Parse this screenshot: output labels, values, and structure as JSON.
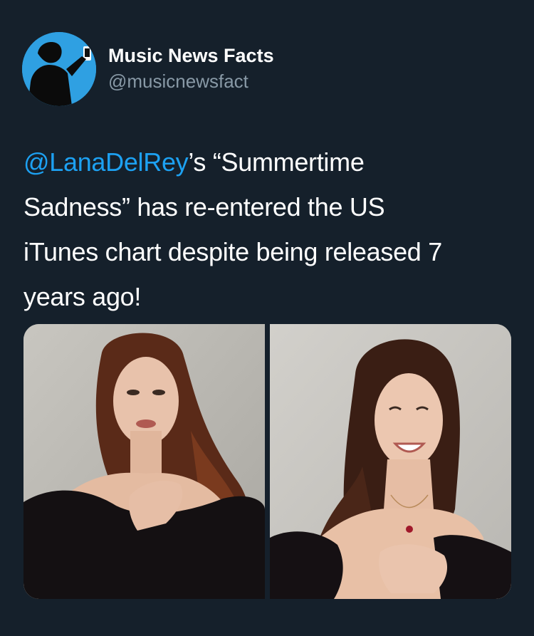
{
  "account": {
    "display_name": "Music News Facts",
    "handle": "@musicnewsfact",
    "avatar_icon": "silhouette-selfie-icon",
    "avatar_color": "#2fa0e2"
  },
  "tweet": {
    "mention": "@LanaDelRey",
    "text_line1_rest": "’s “Summertime",
    "text_line2": "Sadness” has re-entered the US",
    "text_line3": "iTunes chart despite being released 7",
    "text_line4": "years ago!"
  },
  "media": {
    "photos": [
      {
        "name": "photo-left",
        "subject": "portrait"
      },
      {
        "name": "photo-right",
        "subject": "portrait"
      }
    ]
  },
  "colors": {
    "background": "#15202b",
    "link": "#1da1f2",
    "secondary_text": "#8899a6"
  }
}
